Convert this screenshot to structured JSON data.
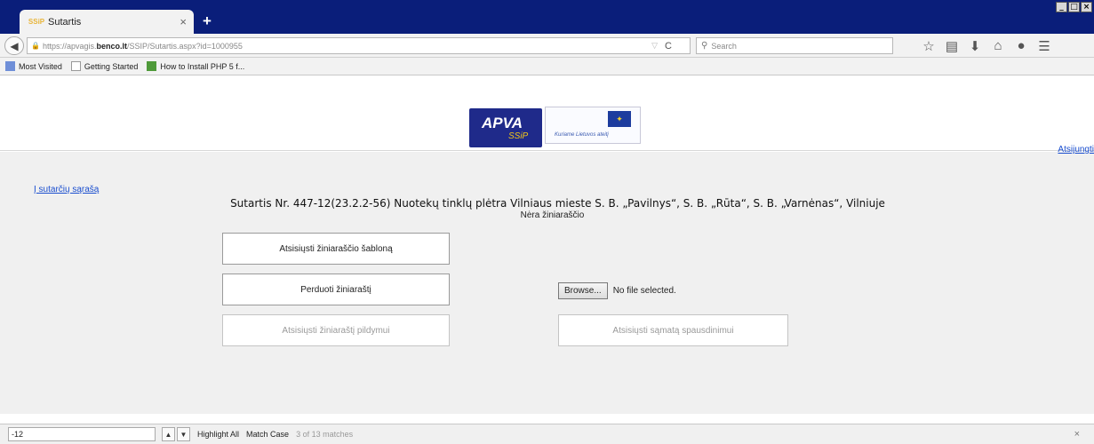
{
  "browser": {
    "tab_title": "Sutartis",
    "tab_favicon_text": "SSiP",
    "url_prefix": "https://apvagis.",
    "url_host": "benco.lt",
    "url_path": "/SSIP/Sutartis.aspx?id=1000955",
    "search_placeholder": "Search",
    "window_controls": [
      "_",
      "□",
      "×"
    ]
  },
  "bookmarks": [
    {
      "label": "Most Visited"
    },
    {
      "label": "Getting Started"
    },
    {
      "label": "How to Install PHP 5 f..."
    }
  ],
  "header": {
    "logo_apva_text": "APVA",
    "logo_apva_sub": "SSiP",
    "logo_eu_caption": "Kuriame Lietuvos ateitį"
  },
  "page": {
    "logout_label": "Atsijungti",
    "back_link_label": "Į sutarčių sąrašą",
    "contract_title": "Sutartis Nr. 447-12(23.2.2-56) Nuotekų tinklų plėtra Vilniaus mieste S. B. „Pavilnys“, S. B. „Rūta“, S. B. „Varnėnas“, Vilniuje",
    "no_sheet_text": "Nėra žiniaraščio",
    "buttons": {
      "download_template": "Atsisiųsti žiniaraščio šabloną",
      "submit_sheet": "Perduoti žiniaraštį",
      "download_fill": "Atsisiųsti žiniaraštį pildymui",
      "download_estimate": "Atsisiųsti sąmatą spausdinimui"
    },
    "file_input": {
      "browse_label": "Browse...",
      "status": "No file selected."
    }
  },
  "findbar": {
    "query": "-12",
    "highlight_all": "Highlight All",
    "match_case": "Match Case",
    "status": "3 of 13 matches"
  },
  "colors": {
    "titlebar": "#0a1e7a",
    "link": "#1a4ecf",
    "page_bg": "#f0f0f0"
  }
}
